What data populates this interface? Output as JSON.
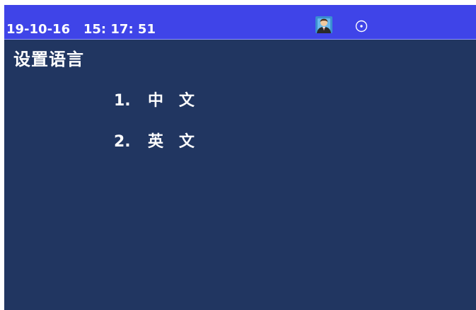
{
  "status_bar": {
    "datetime": "19-10-16   15: 17: 51",
    "icons": [
      "user-avatar-icon",
      "clock-icon"
    ],
    "background": "#3f44e8"
  },
  "screen": {
    "background": "#213661",
    "title": "设置语言",
    "menu": [
      {
        "number": "1.",
        "label": "中文"
      },
      {
        "number": "2.",
        "label": "英文"
      }
    ]
  }
}
